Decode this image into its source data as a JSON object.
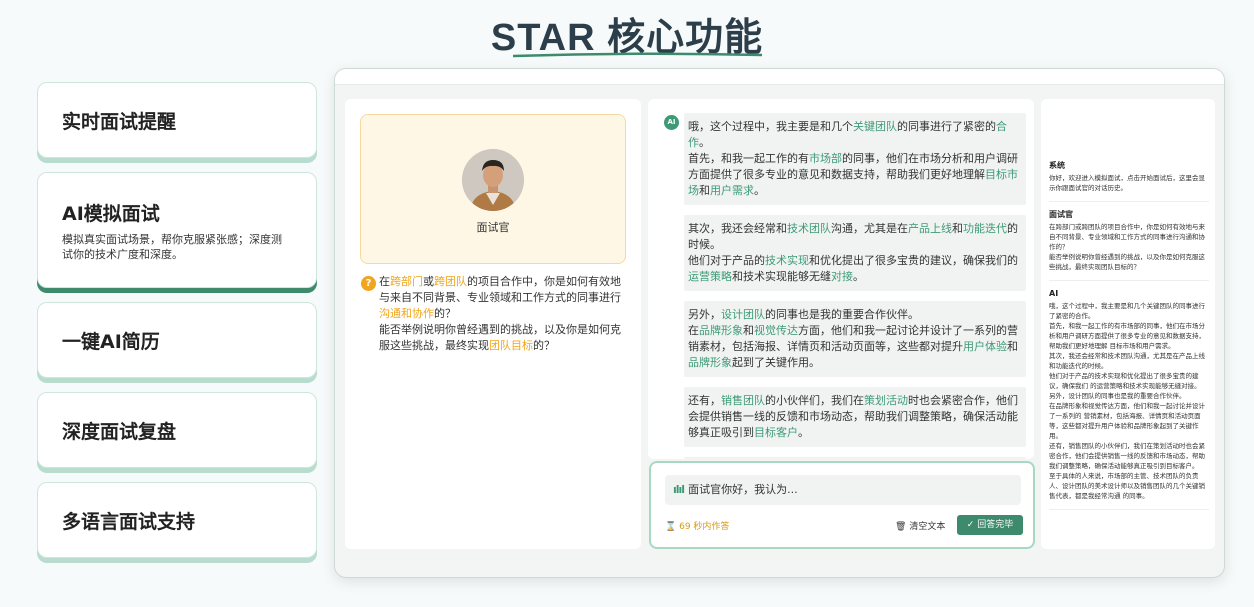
{
  "page_title": "STAR 核心功能",
  "features": [
    {
      "title": "实时面试提醒",
      "desc": ""
    },
    {
      "title": "AI模拟面试",
      "desc": "模拟真实面试场景，帮你克服紧张感；深度测试你的技术广度和深度。"
    },
    {
      "title": "一键AI简历",
      "desc": ""
    },
    {
      "title": "深度面试复盘",
      "desc": ""
    },
    {
      "title": "多语言面试支持",
      "desc": ""
    }
  ],
  "interviewer": {
    "label": "面试官",
    "question_parts": [
      {
        "t": "在",
        "c": ""
      },
      {
        "t": "跨部门",
        "c": "o"
      },
      {
        "t": "或",
        "c": ""
      },
      {
        "t": "跨团队",
        "c": "o"
      },
      {
        "t": "的项目合作中，你是如何有效地与来自不同背景、专业领域和工作方式的同事进行",
        "c": ""
      },
      {
        "t": "沟通和协作",
        "c": "o"
      },
      {
        "t": "的？",
        "c": ""
      },
      {
        "t": "\n",
        "c": ""
      },
      {
        "t": "能否举例说明你曾经遇到的挑战，以及你是如何克服这些挑战，最终实现",
        "c": ""
      },
      {
        "t": "团队目标",
        "c": "o"
      },
      {
        "t": "的？",
        "c": ""
      }
    ]
  },
  "ai_badge": "AI",
  "messages": [
    [
      {
        "t": "哦，这个过程中，我主要是和几个",
        "c": ""
      },
      {
        "t": "关键团队",
        "c": "g"
      },
      {
        "t": "的同事进行了紧密的",
        "c": ""
      },
      {
        "t": "合作",
        "c": "g"
      },
      {
        "t": "。\n首先，和我一起工作的有",
        "c": ""
      },
      {
        "t": "市场部",
        "c": "g"
      },
      {
        "t": "的同事，他们在市场分析和用户调研方面提供了很多专业的意见和数据支持，帮助我们更好地理解",
        "c": ""
      },
      {
        "t": "目标市场",
        "c": "g"
      },
      {
        "t": "和",
        "c": ""
      },
      {
        "t": "用户需求",
        "c": "g"
      },
      {
        "t": "。",
        "c": ""
      }
    ],
    [
      {
        "t": "其次，我还会经常和",
        "c": ""
      },
      {
        "t": "技术团队",
        "c": "g"
      },
      {
        "t": "沟通，尤其是在",
        "c": ""
      },
      {
        "t": "产品上线",
        "c": "g"
      },
      {
        "t": "和",
        "c": ""
      },
      {
        "t": "功能迭代",
        "c": "g"
      },
      {
        "t": "的时候。\n他们对于产品的",
        "c": ""
      },
      {
        "t": "技术实现",
        "c": "g"
      },
      {
        "t": "和优化提出了很多宝贵的建议，确保我们的",
        "c": ""
      },
      {
        "t": "运营策略",
        "c": "g"
      },
      {
        "t": "和技术实现能够无缝",
        "c": ""
      },
      {
        "t": "对接",
        "c": "g"
      },
      {
        "t": "。",
        "c": ""
      }
    ],
    [
      {
        "t": "另外，",
        "c": ""
      },
      {
        "t": "设计团队",
        "c": "g"
      },
      {
        "t": "的同事也是我的重要合作伙伴。\n在",
        "c": ""
      },
      {
        "t": "品牌形象",
        "c": "g"
      },
      {
        "t": "和",
        "c": ""
      },
      {
        "t": "视觉传达",
        "c": "g"
      },
      {
        "t": "方面，他们和我一起讨论并设计了一系列的营销素材，包括海报、详情页和活动页面等，这些都对提升",
        "c": ""
      },
      {
        "t": "用户体验",
        "c": "g"
      },
      {
        "t": "和",
        "c": ""
      },
      {
        "t": "品牌形象",
        "c": "g"
      },
      {
        "t": "起到了关键作用。",
        "c": ""
      }
    ],
    [
      {
        "t": "还有，",
        "c": ""
      },
      {
        "t": "销售团队",
        "c": "g"
      },
      {
        "t": "的小伙伴们，我们在",
        "c": ""
      },
      {
        "t": "策划活动",
        "c": "g"
      },
      {
        "t": "时也会紧密合作，他们会提供销售一线的反馈和市场动态，帮助我们调整策略，确保活动能够真正吸引到",
        "c": ""
      },
      {
        "t": "目标客户",
        "c": "g"
      },
      {
        "t": "。",
        "c": ""
      }
    ],
    [
      {
        "t": "至于具体的人来说，市场部的主管、技术团队的负责人、设计团队的",
        "c": ""
      },
      {
        "t": "美术设计师",
        "c": "g"
      },
      {
        "t": "以及销售团队的几个关键",
        "c": ""
      },
      {
        "t": "销售代表",
        "c": "g"
      },
      {
        "t": "，都是我经常沟通的同事。",
        "c": ""
      }
    ]
  ],
  "input": {
    "value": "面试官你好，我认为...",
    "timer": "69 秒内作答",
    "clear_label": "清空文本",
    "done_label": "回答完毕"
  },
  "history": [
    {
      "role": "系统",
      "text": "你好，欢迎进入模拟面试，点击开始面试后，这里会显示你跟面试官的对话历史。"
    },
    {
      "role": "面试官",
      "text": "在跨部门或跨团队的项目合作中，你是如何有效地与来自不同背景、专业领域和工作方式的同事进行沟通和协作的？\n能否举例说明你曾经遇到的挑战，以及你是如何克服这些挑战，最终实现团队目标的？"
    },
    {
      "role": "AI",
      "text": "哦，这个过程中，我主要是和几个关键团队的同事进行了紧密的合作。\n首先，和我一起工作的有市场部的同事，他们在市场分析和用户调研方面提供了很多专业的意见和数据支持，帮助我们更好地理解 目标市场和用户需求。\n其次，我还会经常和技术团队沟通，尤其是在产品上线和功能迭代的时候。\n他们对于产品的技术实现和优化提出了很多宝贵的建议，确保我们 的运营策略和技术实现能够无缝对接。\n另外，设计团队的同事也是我的重要合作伙伴。\n在品牌形象和视觉传达方面，他们和我一起讨论并设计了一系列的 营销素材，包括海报、详情页和活动页面等，这些都对提升用户体验和品牌形象起到了关键作用。\n还有，销售团队的小伙伴们，我们在策划活动时也会紧密合作，他们会提供销售一线的反馈和市场动态，帮助我们调整策略，确保活动能够真正吸引到目标客户。\n至于具体的人来说，市场部的主管、技术团队的负责人、设计团队的美术设计师以及销售团队的几个关键销售代表，都是我经常沟通 的同事。"
    }
  ],
  "colors": {
    "accent": "#3d9a76",
    "highlight": "#f0a51c",
    "title": "#2c3e4a"
  }
}
